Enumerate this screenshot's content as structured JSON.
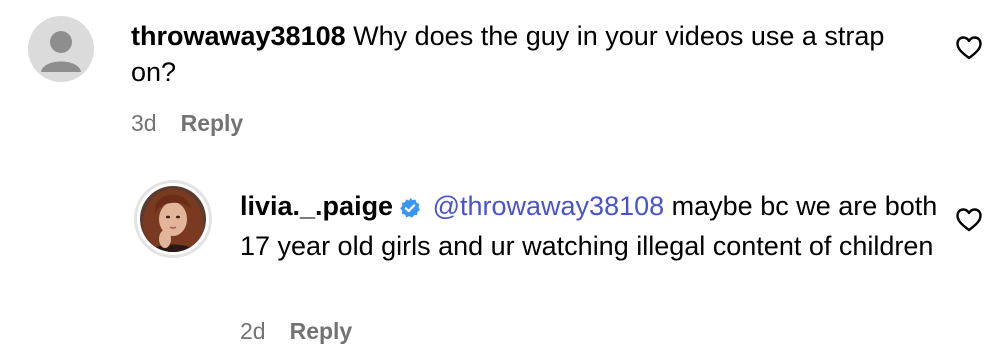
{
  "comments": [
    {
      "username": "throwaway38108",
      "text": "Why does the guy in your videos use a strap on?",
      "time": "3d",
      "reply_label": "Reply",
      "avatar": "default-avatar",
      "like_icon": "heart-outline-icon"
    },
    {
      "username": "livia._.paige",
      "verified_icon": "verified-badge-icon",
      "mention": "@throwaway38108",
      "text": "maybe bc we are both 17 year old girls and ur watching illegal content of children",
      "time": "2d",
      "reply_label": "Reply",
      "avatar": "profile-photo",
      "like_icon": "heart-outline-icon"
    }
  ],
  "colors": {
    "text": "#000000",
    "meta": "#737373",
    "mention": "#4953cc",
    "verified": "#3897f0",
    "avatar_default": "#dbdbdb"
  }
}
